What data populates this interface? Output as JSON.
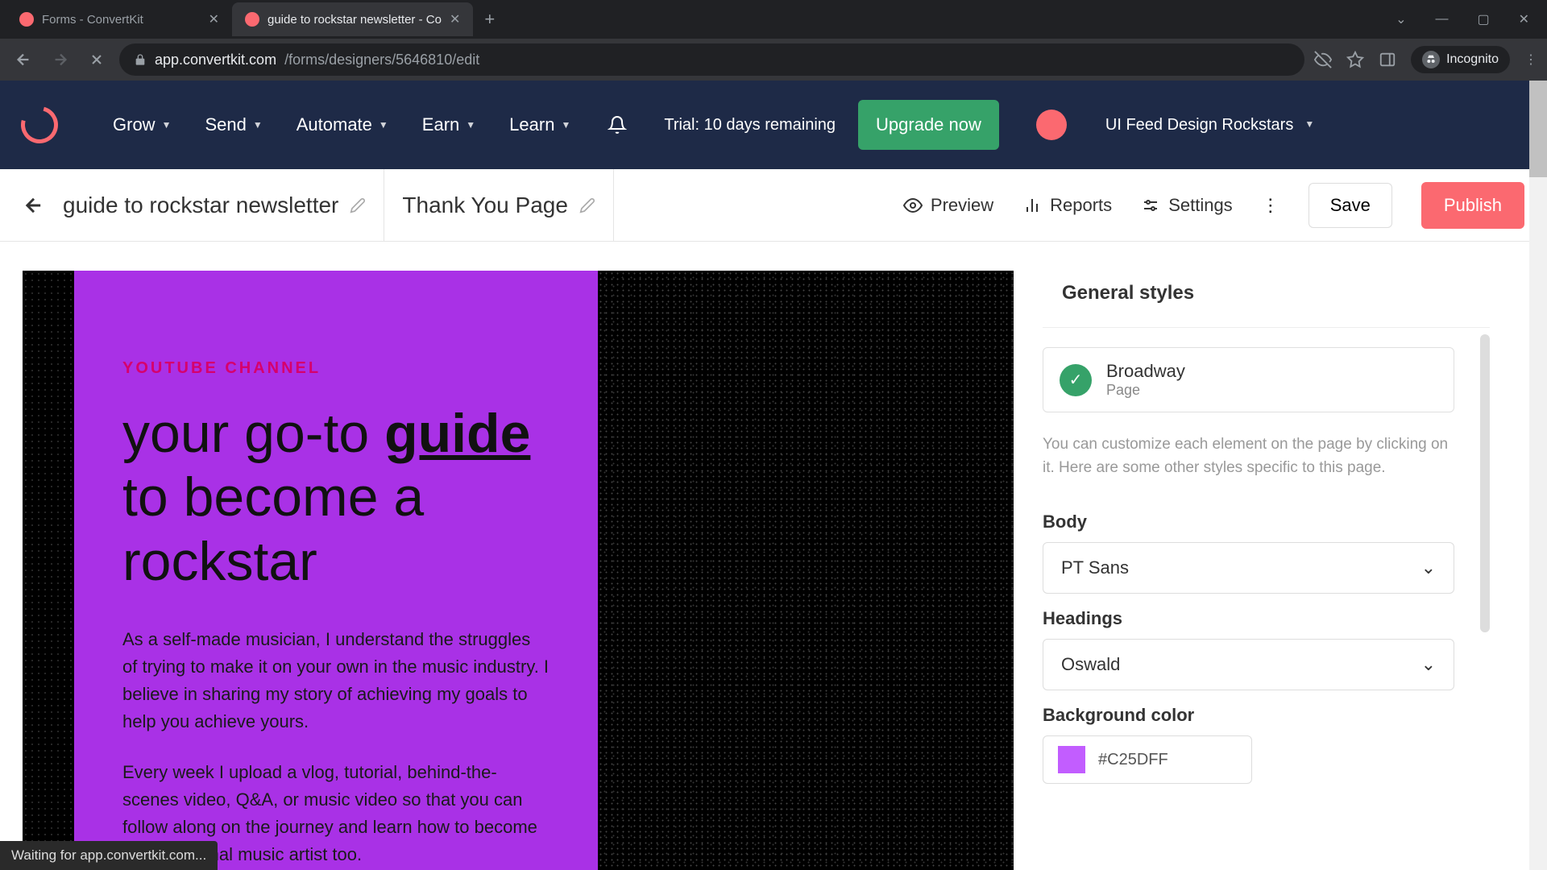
{
  "browser": {
    "tabs": [
      {
        "title": "Forms - ConvertKit",
        "active": false
      },
      {
        "title": "guide to rockstar newsletter - Co",
        "active": true
      }
    ],
    "url_host": "app.convertkit.com",
    "url_path": "/forms/designers/5646810/edit",
    "incognito_label": "Incognito"
  },
  "topnav": {
    "links": [
      "Grow",
      "Send",
      "Automate",
      "Earn",
      "Learn"
    ],
    "trial": "Trial: 10 days remaining",
    "upgrade": "Upgrade now",
    "account": "UI Feed Design Rockstars"
  },
  "secbar": {
    "form_name": "guide to rockstar newsletter",
    "page_name": "Thank You Page",
    "preview": "Preview",
    "reports": "Reports",
    "settings": "Settings",
    "save": "Save",
    "publish": "Publish"
  },
  "canvas": {
    "eyebrow": "YOUTUBE CHANNEL",
    "headline_pre": "your go-to ",
    "headline_underline": "guide",
    "headline_post": " to become a rockstar",
    "p1": "As a self-made musician, I understand the struggles of trying to make it on your own in the music industry. I believe in sharing my story of achieving my goals to help you achieve yours.",
    "p2": "Every week I upload a vlog, tutorial, behind-the-scenes video, Q&A, or music video so that you can follow along on the journey and learn how to become a professional music artist too."
  },
  "sidebar": {
    "title": "General styles",
    "template_name": "Broadway",
    "template_sub": "Page",
    "help": "You can customize each element on the page by clicking on it. Here are some other styles specific to this page.",
    "body_label": "Body",
    "body_font": "PT Sans",
    "headings_label": "Headings",
    "headings_font": "Oswald",
    "bgcolor_label": "Background color",
    "bgcolor_hex": "#C25DFF"
  },
  "status": "Waiting for app.convertkit.com..."
}
